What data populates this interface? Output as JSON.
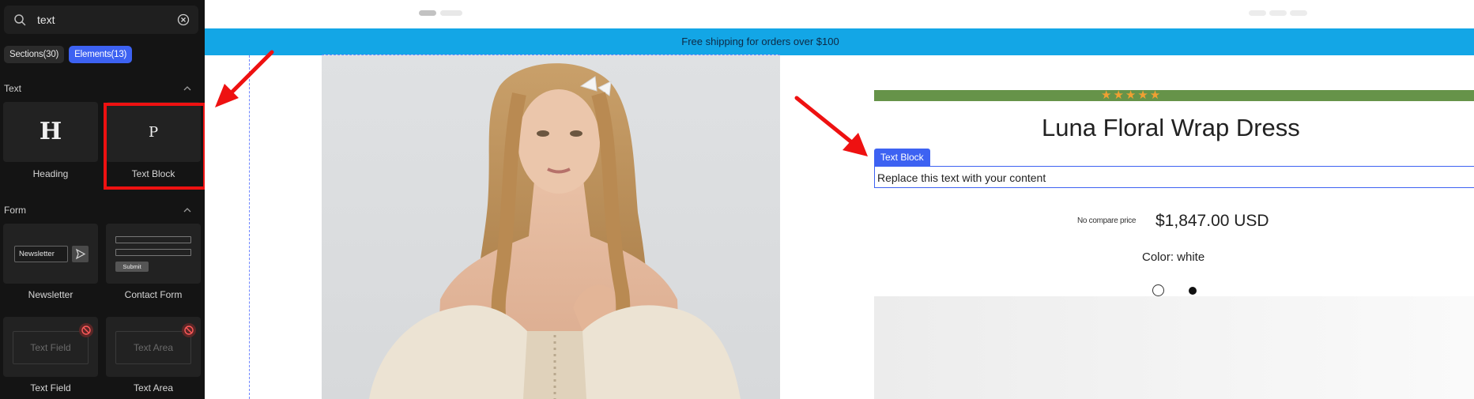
{
  "sidebar": {
    "search": {
      "value": "text",
      "icon": "search-icon",
      "clear_icon": "clear-circle-icon"
    },
    "tabs": [
      {
        "label": "Sections(30)",
        "active": false
      },
      {
        "label": "Elements(13)",
        "active": true
      }
    ],
    "groups": {
      "text": {
        "title": "Text",
        "items": [
          {
            "label": "Heading",
            "glyph": "H"
          },
          {
            "label": "Text Block",
            "glyph": "P"
          }
        ]
      },
      "form": {
        "title": "Form",
        "items": [
          {
            "label": "Newsletter",
            "preview_input": "Newsletter"
          },
          {
            "label": "Contact Form",
            "preview_submit": "Submit"
          },
          {
            "label": "Text Field",
            "preview_placeholder": "Text Field"
          },
          {
            "label": "Text Area",
            "preview_placeholder": "Text Area"
          }
        ]
      }
    }
  },
  "canvas": {
    "announcement": "Free shipping for orders over $100",
    "product": {
      "rating_stars": "★★★★★",
      "title": "Luna Floral Wrap Dress",
      "selected_block_tag": "Text Block",
      "text_block": "Replace this text with your content",
      "compare_price": "No compare price",
      "price": "$1,847.00 USD",
      "color_label": "Color: white",
      "swatches": [
        "white",
        "black"
      ]
    }
  },
  "colors": {
    "panel_bg": "#141414",
    "accent_blue": "#3d62f2",
    "banner_blue": "#13a6e6",
    "rating_green": "#669349",
    "highlight_red": "#ee1111"
  }
}
